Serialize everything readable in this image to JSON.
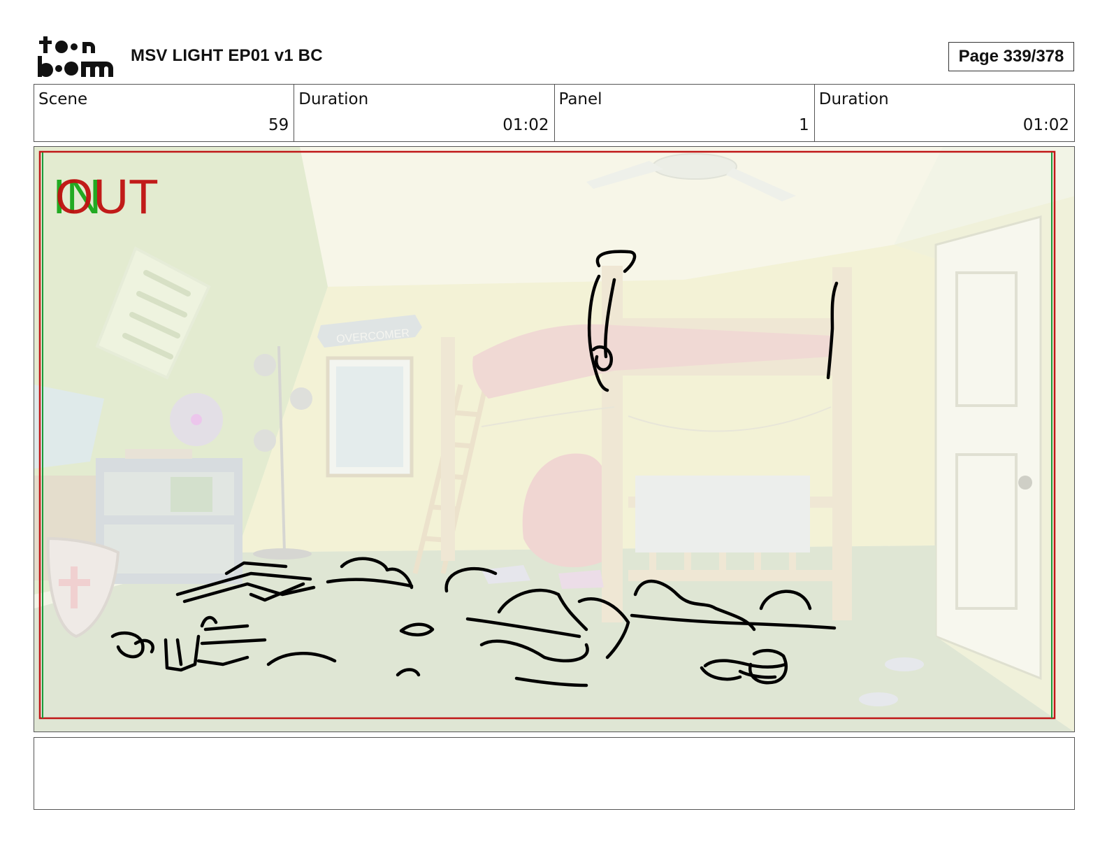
{
  "header": {
    "logo_text": "toon boom",
    "document_title": "MSV LIGHT EP01 v1 BC",
    "page_indicator": "Page 339/378"
  },
  "info": {
    "scene_label": "Scene",
    "scene_value": "59",
    "scene_duration_label": "Duration",
    "scene_duration_value": "01:02",
    "panel_label": "Panel",
    "panel_value": "1",
    "panel_duration_label": "Duration",
    "panel_duration_value": "01:02"
  },
  "panel": {
    "in_marker": "IN",
    "out_marker": "OUT",
    "wall_sign": "OVERCOMER",
    "colors": {
      "in_marker": "#22aa22",
      "out_marker": "#c01010",
      "frame_red": "#c01818",
      "frame_green": "#1a9a3a"
    }
  },
  "caption": {
    "text": ""
  }
}
